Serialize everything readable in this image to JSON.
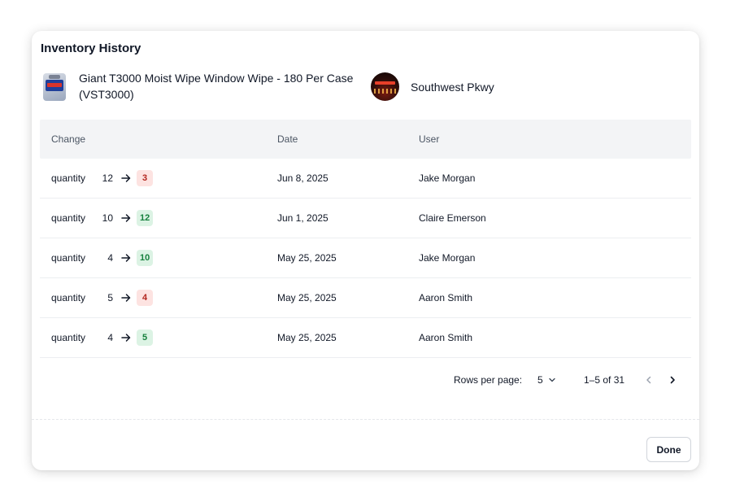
{
  "modal": {
    "title": "Inventory History",
    "done_label": "Done"
  },
  "product": {
    "name": "Giant T3000 Moist Wipe Window Wipe - 180 Per Case (VST3000)",
    "thumbnail_icon": "product-image"
  },
  "location": {
    "name": "Southwest Pkwy",
    "avatar_icon": "location-avatar"
  },
  "table": {
    "headers": {
      "change": "Change",
      "date": "Date",
      "user": "User"
    },
    "rows": [
      {
        "field": "quantity",
        "old": "12",
        "new": "3",
        "direction": "down",
        "date": "Jun 8, 2025",
        "user": "Jake Morgan"
      },
      {
        "field": "quantity",
        "old": "10",
        "new": "12",
        "direction": "up",
        "date": "Jun 1, 2025",
        "user": "Claire Emerson"
      },
      {
        "field": "quantity",
        "old": "4",
        "new": "10",
        "direction": "up",
        "date": "May 25, 2025",
        "user": "Jake Morgan"
      },
      {
        "field": "quantity",
        "old": "5",
        "new": "4",
        "direction": "down",
        "date": "May 25, 2025",
        "user": "Aaron Smith"
      },
      {
        "field": "quantity",
        "old": "4",
        "new": "5",
        "direction": "up",
        "date": "May 25, 2025",
        "user": "Aaron Smith"
      }
    ]
  },
  "pagination": {
    "rows_per_page_label": "Rows per page:",
    "rows_per_page_value": "5",
    "range_text": "1–5 of 31"
  },
  "colors": {
    "decrease_bg": "#fde3e1",
    "decrease_text": "#b3261e",
    "increase_bg": "#dcf3e4",
    "increase_text": "#17803d",
    "header_bg": "#f3f4f6"
  }
}
